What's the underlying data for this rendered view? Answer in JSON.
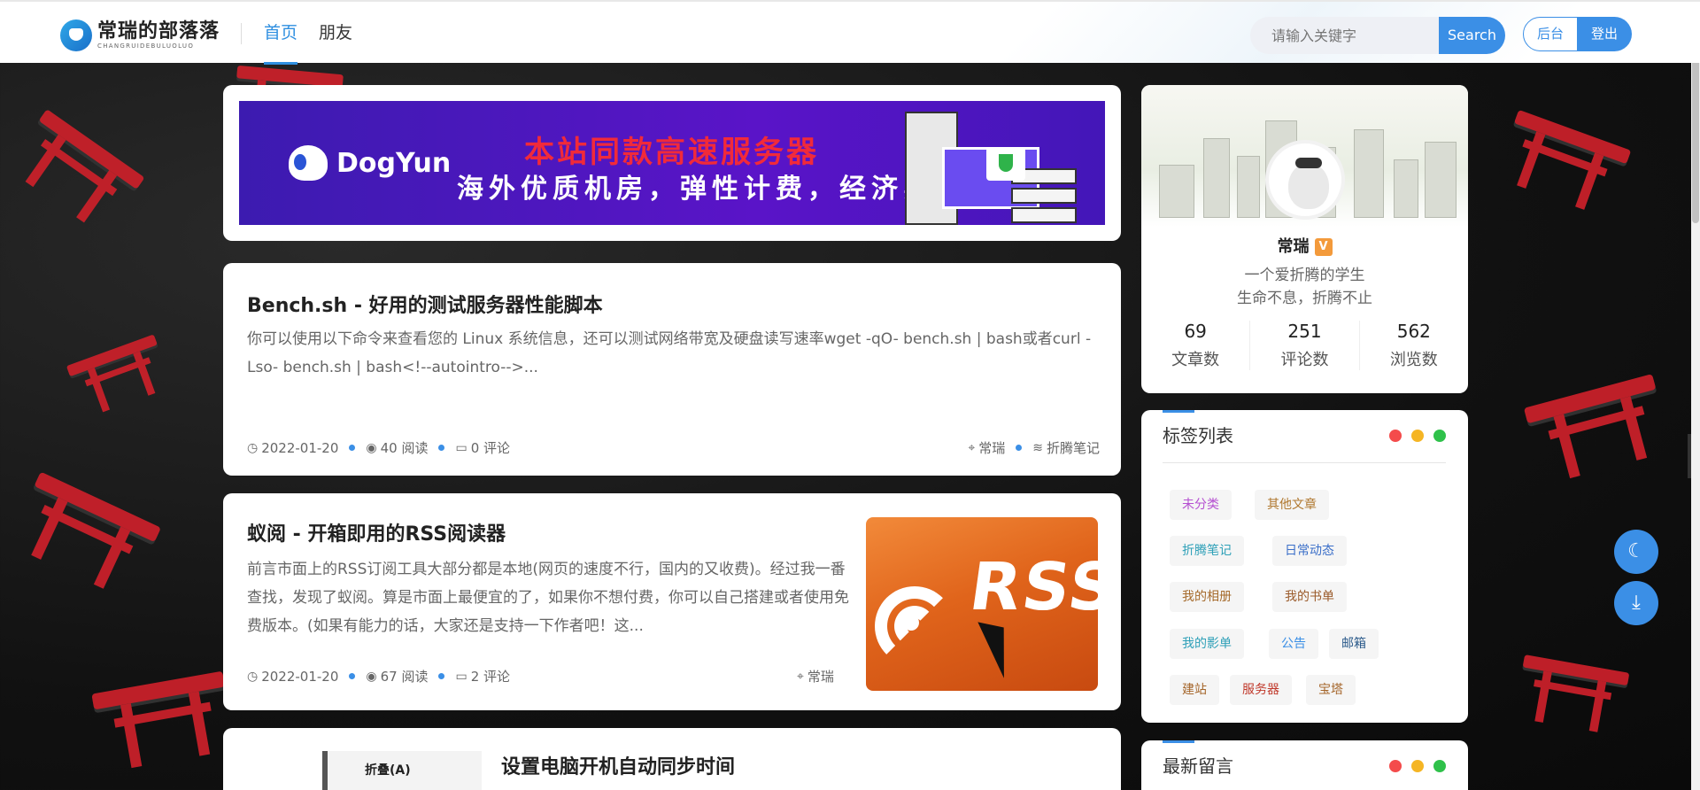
{
  "header": {
    "logo_main": "常瑞的部落落",
    "logo_sub": "CHANGRUIDEBULUOLUO",
    "nav": [
      {
        "label": "首页",
        "active": true
      },
      {
        "label": "朋友",
        "active": false
      }
    ],
    "search_placeholder": "请输入关键字",
    "search_button": "Search",
    "admin_button": "后台",
    "logout_button": "登出"
  },
  "banner": {
    "brand": "DogYun",
    "title": "本站同款高速服务器",
    "subtitle": "海外优质机房，弹性计费，经济实惠"
  },
  "posts": [
    {
      "title": "Bench.sh - 好用的测试服务器性能脚本",
      "excerpt": "你可以使用以下命令来查看您的 Linux 系统信息，还可以测试网络带宽及硬盘读写速率wget -qO- bench.sh | bash或者curl -Lso- bench.sh | bash<!--autointro-->...",
      "date": "2022-01-20",
      "views": "40 阅读",
      "comments": "0 评论",
      "author": "常瑞",
      "category": "折腾笔记"
    },
    {
      "title": "蚁阅 - 开箱即用的RSS阅读器",
      "excerpt": "前言市面上的RSS订阅工具大部分都是本地(网页的速度不行，国内的又收费)。经过我一番查找，发现了蚁阅。算是市面上最便宜的了，如果你不想付费，你可以自己搭建或者使用免费版本。(如果有能力的话，大家还是支持一下作者吧！这...",
      "date": "2022-01-20",
      "views": "67 阅读",
      "comments": "2 评论",
      "author": "常瑞",
      "image_text": "RSS"
    },
    {
      "title": "设置电脑开机自动同步时间",
      "image_label": "折叠(A)"
    }
  ],
  "profile": {
    "name": "常瑞",
    "badge": "V",
    "bio_line1": "一个爱折腾的学生",
    "bio_line2": "生命不息，折腾不止",
    "stats": [
      {
        "num": "69",
        "label": "文章数"
      },
      {
        "num": "251",
        "label": "评论数"
      },
      {
        "num": "562",
        "label": "浏览数"
      }
    ]
  },
  "tags_widget": {
    "title": "标签列表",
    "tags": [
      {
        "label": "未分类",
        "color": "#b54fd1"
      },
      {
        "label": "其他文章",
        "color": "#b0782f"
      },
      {
        "label": "折腾笔记",
        "color": "#2ea0b8"
      },
      {
        "label": "日常动态",
        "color": "#3b6fc9"
      },
      {
        "label": "我的相册",
        "color": "#a56a2b"
      },
      {
        "label": "我的书单",
        "color": "#9a5a2a"
      },
      {
        "label": "我的影单",
        "color": "#2ea0b8"
      },
      {
        "label": "公告",
        "color": "#3b8fe6"
      },
      {
        "label": "邮箱",
        "color": "#2b5a8a"
      },
      {
        "label": "建站",
        "color": "#a5662b"
      },
      {
        "label": "服务器",
        "color": "#c0392b"
      },
      {
        "label": "宝塔",
        "color": "#a5662b"
      }
    ]
  },
  "comments_widget": {
    "title": "最新留言"
  },
  "colors": {
    "accent": "#3b8fe6",
    "dot_red": "#f44b4b",
    "dot_yellow": "#f5b524",
    "dot_green": "#2fc14a"
  },
  "float_buttons": [
    {
      "icon": "moon-icon"
    },
    {
      "icon": "download-icon"
    }
  ]
}
